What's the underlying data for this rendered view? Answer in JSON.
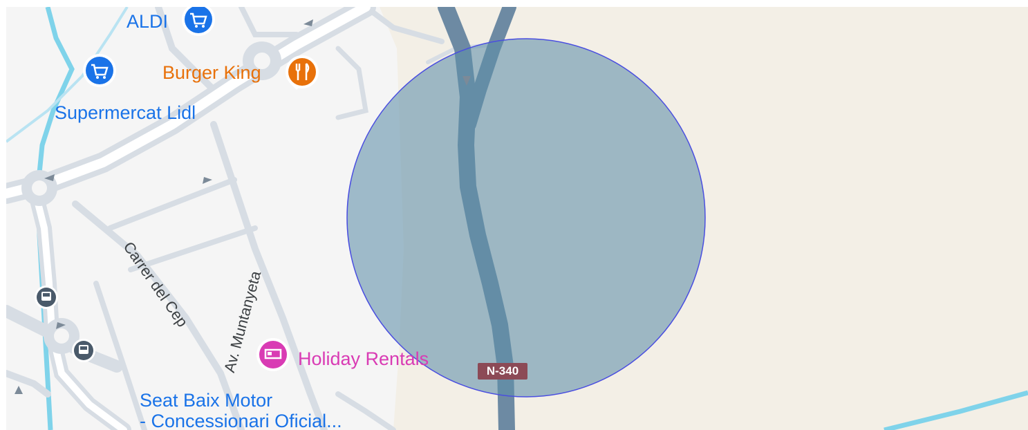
{
  "map": {
    "pois": [
      {
        "name": "ALDI",
        "category": "shopping-cart-icon",
        "color": "#1a73e8"
      },
      {
        "name": "Burger King",
        "category": "restaurant-icon",
        "color": "#e8710a"
      },
      {
        "name": "Supermercat Lidl",
        "category": "shopping-cart-icon",
        "color": "#1a73e8"
      },
      {
        "name": "Holiday Rentals",
        "category": "hotel-bed-icon",
        "color": "#d93bb4"
      },
      {
        "name": "Seat Baix Motor",
        "category": "place",
        "color": "#1a73e8"
      },
      {
        "name": "- Concessionari Oficial...",
        "category": "place",
        "color": "#1a73e8"
      }
    ],
    "streets": [
      {
        "name": "Carrer del Cep"
      },
      {
        "name": "Av. Muntanyeta"
      }
    ],
    "road_shield": {
      "label": "N-340",
      "color": "#8c4a56"
    },
    "overlay": {
      "shape": "circle",
      "fill": "#5f8fa8",
      "stroke": "#4a4ee0"
    },
    "colors": {
      "urban_bg": "#f5f5f5",
      "rural_bg": "#f3efe6",
      "road": "#d7dde4",
      "highway": "#6d8aa3",
      "water": "#7fd3ea"
    }
  }
}
